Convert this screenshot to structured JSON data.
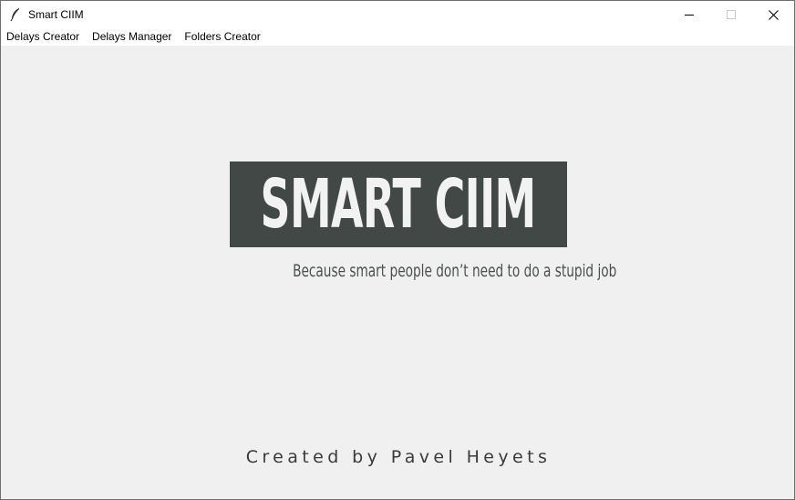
{
  "window": {
    "title": "Smart CIIM",
    "icon": "feather-icon",
    "controls": [
      "minimize-icon",
      "maximize-icon",
      "close-icon"
    ]
  },
  "menubar": {
    "items": [
      "Delays Creator",
      "Delays Manager",
      "Folders Creator"
    ]
  },
  "main": {
    "logo_text": "SMART CIIM",
    "tagline": "Because smart people don’t need to do a stupid job",
    "credit": "Created by Pavel Heyets"
  },
  "colors": {
    "logo_background": "#424846",
    "logo_text": "#f2f2f2",
    "window_background": "#f0f0f0"
  }
}
